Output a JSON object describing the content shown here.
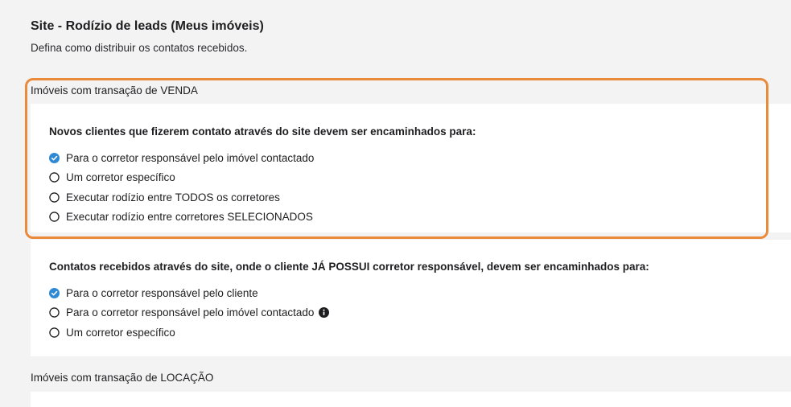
{
  "page": {
    "title": "Site - Rodízio de leads (Meus imóveis)",
    "subtitle": "Defina como distribuir os contatos recebidos."
  },
  "sections": {
    "venda": {
      "title": "Imóveis com transação de VENDA",
      "new_clients": {
        "question": "Novos clientes que fizerem contato através do site devem ser encaminhados para:",
        "options": [
          {
            "label": "Para o corretor responsável pelo imóvel contactado",
            "selected": true
          },
          {
            "label": "Um corretor específico",
            "selected": false
          },
          {
            "label": "Executar rodízio entre TODOS os corretores",
            "selected": false
          },
          {
            "label": "Executar rodízio entre corretores SELECIONADOS",
            "selected": false
          }
        ]
      },
      "existing_clients": {
        "question": "Contatos recebidos através do site, onde o cliente JÁ POSSUI corretor responsável, devem ser encaminhados para:",
        "options": [
          {
            "label": "Para o corretor responsável pelo cliente",
            "selected": true
          },
          {
            "label": "Para o corretor responsável pelo imóvel contactado",
            "selected": false,
            "info_icon": "info-icon"
          },
          {
            "label": "Um corretor específico",
            "selected": false
          }
        ]
      }
    },
    "locacao": {
      "title": "Imóveis com transação de LOCAÇÃO"
    }
  },
  "colors": {
    "radio_selected": "#2d89d6",
    "highlight_border": "#ea8a3b",
    "page_background": "#f3f3f4",
    "card_background": "#ffffff"
  }
}
